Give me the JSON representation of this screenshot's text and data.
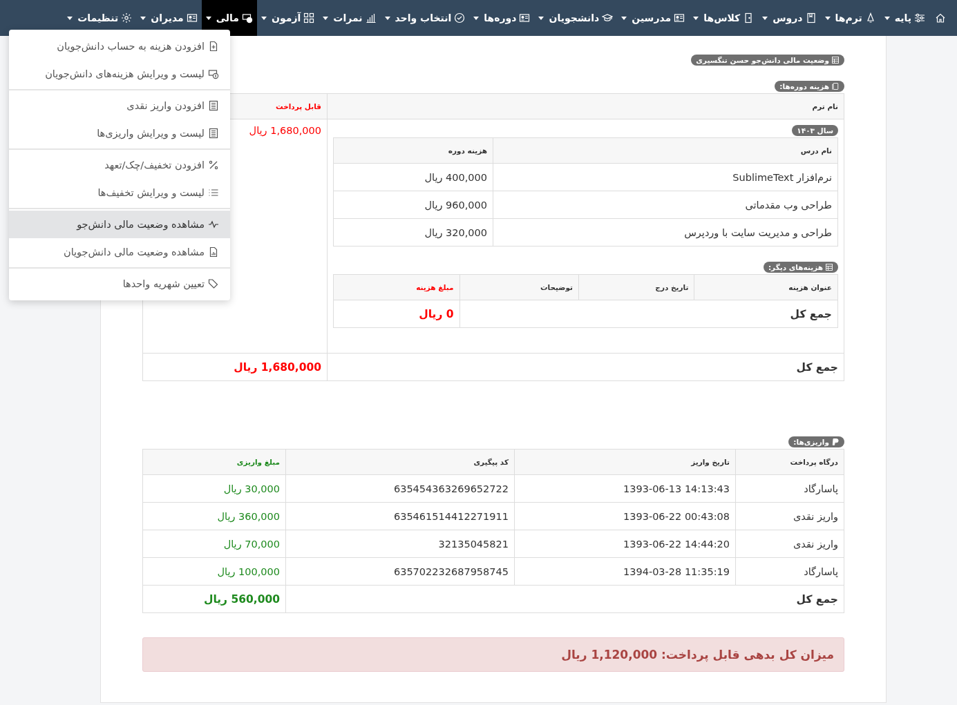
{
  "navbar": {
    "items": [
      {
        "label": "پایه",
        "selected": false
      },
      {
        "label": "ترم‌ها",
        "selected": false
      },
      {
        "label": "دروس",
        "selected": false
      },
      {
        "label": "کلاس‌ها",
        "selected": false
      },
      {
        "label": "مدرسین",
        "selected": false
      },
      {
        "label": "دانشجویان",
        "selected": false
      },
      {
        "label": "دوره‌ها",
        "selected": false
      },
      {
        "label": "انتخاب واحد",
        "selected": false
      },
      {
        "label": "نمرات",
        "selected": false
      },
      {
        "label": "آزمون",
        "selected": false
      },
      {
        "label": "مالی",
        "selected": true
      },
      {
        "label": "مدیران",
        "selected": false
      },
      {
        "label": "تنظیمات",
        "selected": false
      }
    ]
  },
  "dropdown": {
    "groups": [
      [
        {
          "label": "افزودن هزینه به حساب دانش‌جویان",
          "selected": false
        },
        {
          "label": "لیست و ویرایش هزینه‌های دانش‌جویان",
          "selected": false
        }
      ],
      [
        {
          "label": "افزودن واریز نقدی",
          "selected": false
        },
        {
          "label": "لیست و ویرایش واریزی‌ها",
          "selected": false
        }
      ],
      [
        {
          "label": "افزودن تخفیف/چک/تعهد",
          "selected": false
        },
        {
          "label": "لیست و ویرایش تخفیف‌ها",
          "selected": false
        }
      ],
      [
        {
          "label": "مشاهده وضعیت مالی دانش‌جو",
          "selected": true
        },
        {
          "label": "مشاهده وضعیت مالی دانش‌جویان",
          "selected": false
        }
      ],
      [
        {
          "label": "تعیین شهریه واحدها",
          "selected": false
        }
      ]
    ]
  },
  "page": {
    "title": "وضعیت مالی دانش‌جو حسن تنگسیری"
  },
  "course_costs": {
    "title": "هزینه دوره‌ها:",
    "columns": [
      "نام ترم",
      "قابل پرداخت"
    ],
    "terms": [
      {
        "year": "سال ۱۴۰۳",
        "payable": "1,680,000 ریال",
        "courses": {
          "columns": [
            "نام درس",
            "هزینه دوره"
          ],
          "rows": [
            [
              "نرم‌افزار SublimeText",
              "400,000 ریال"
            ],
            [
              "طراحی وب مقدماتی",
              "960,000 ریال"
            ],
            [
              "طراحی و مدیریت سایت با وردپرس",
              "320,000 ریال"
            ]
          ]
        },
        "other_costs": {
          "title": "هزینه‌های دیگر:",
          "columns": [
            "عنوان هزینه",
            "تاریخ درج",
            "توضیحات",
            "مبلغ هزینه"
          ],
          "total_label": "جمع کل",
          "total": "0 ریال"
        }
      }
    ],
    "total_label": "جمع کل",
    "total": "1,680,000 ریال"
  },
  "payments": {
    "title": "واریزی‌ها:",
    "columns": [
      "درگاه پرداخت",
      "تاریخ واریز",
      "کد پیگیری",
      "مبلغ واریزی"
    ],
    "rows": [
      [
        "پاسارگاد",
        "1393-06-13 14:13:43",
        "635454363269652722",
        "30,000 ریال"
      ],
      [
        "واریز نقدی",
        "1393-06-22 00:43:08",
        "635461514412271911",
        "360,000 ریال"
      ],
      [
        "واریز نقدی",
        "1393-06-22 14:44:20",
        "32135045821",
        "70,000 ریال"
      ],
      [
        "پاسارگاد",
        "1394-03-28 11:35:19",
        "635702232687958745",
        "100,000 ریال"
      ]
    ],
    "total_label": "جمع کل",
    "total": "560,000 ریال"
  },
  "alert": "میزان کل بدهی قابل پرداخت: 1,120,000 ریال"
}
